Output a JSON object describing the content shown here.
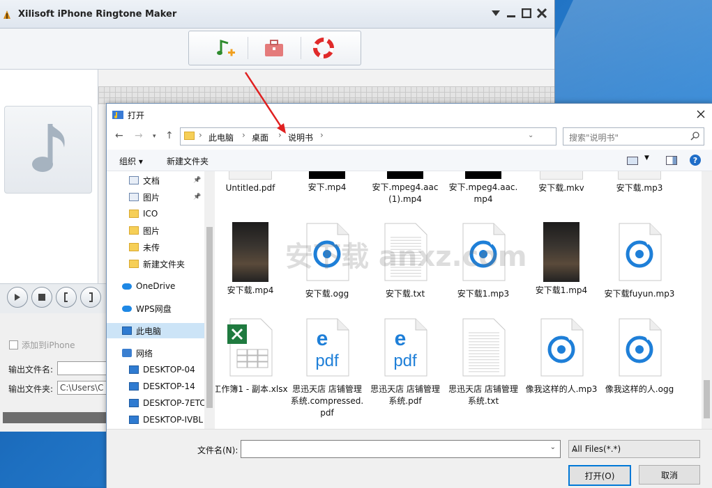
{
  "app": {
    "title": "Xilisoft iPhone Ringtone Maker",
    "add_to_iphone": "添加到iPhone",
    "output_name_label": "输出文件名:",
    "output_folder_label": "输出文件夹:",
    "output_folder_value": "C:\\Users\\C"
  },
  "dialog": {
    "title": "打开",
    "breadcrumb": [
      "此电脑",
      "桌面",
      "说明书"
    ],
    "search_placeholder": "搜索\"说明书\"",
    "organize": "组织",
    "new_folder": "新建文件夹",
    "nav": [
      {
        "label": "文档",
        "icon": "document-icon",
        "pinned": true
      },
      {
        "label": "图片",
        "icon": "pictures-icon",
        "pinned": true
      },
      {
        "label": "ICO",
        "icon": "folder-icon"
      },
      {
        "label": "图片",
        "icon": "folder-icon"
      },
      {
        "label": "未传",
        "icon": "folder-icon"
      },
      {
        "label": "新建文件夹",
        "icon": "folder-icon"
      },
      {
        "label": "OneDrive",
        "icon": "cloud-icon"
      },
      {
        "label": "WPS网盘",
        "icon": "cloud-icon"
      },
      {
        "label": "此电脑",
        "icon": "computer-icon",
        "selected": true
      },
      {
        "label": "网络",
        "icon": "network-icon"
      },
      {
        "label": "DESKTOP-04",
        "icon": "computer-icon"
      },
      {
        "label": "DESKTOP-14",
        "icon": "computer-icon"
      },
      {
        "label": "DESKTOP-7ETC",
        "icon": "computer-icon"
      },
      {
        "label": "DESKTOP-IVBL",
        "icon": "computer-icon"
      }
    ],
    "files_row1": [
      "Untitled.pdf",
      "安下.mp4",
      "安下.mpeg4.aac(1).mp4",
      "安下.mpeg4.aac.mp4",
      "安下载.mkv",
      "安下载.mp3"
    ],
    "files_row2": [
      "安下载.mp4",
      "安下载.ogg",
      "安下载.txt",
      "安下载1.mp3",
      "安下载1.mp4",
      "安下载fuyun.mp3"
    ],
    "files_row3": [
      "工作簿1 - 副本.xlsx",
      "思迅天店 店铺管理系统.compressed.pdf",
      "思迅天店 店铺管理系统.pdf",
      "思迅天店 店铺管理系统.txt",
      "像我这样的人.mp3",
      "像我这样的人.ogg"
    ],
    "filename_label": "文件名(N):",
    "filename_value": "",
    "filetype": "All Files(*.*)",
    "open_button": "打开(O)",
    "cancel_button": "取消",
    "watermark": "安下载 anxz.com"
  },
  "colors": {
    "accent": "#0078d7",
    "arrow": "#e02020",
    "folder": "#f6cf57"
  }
}
